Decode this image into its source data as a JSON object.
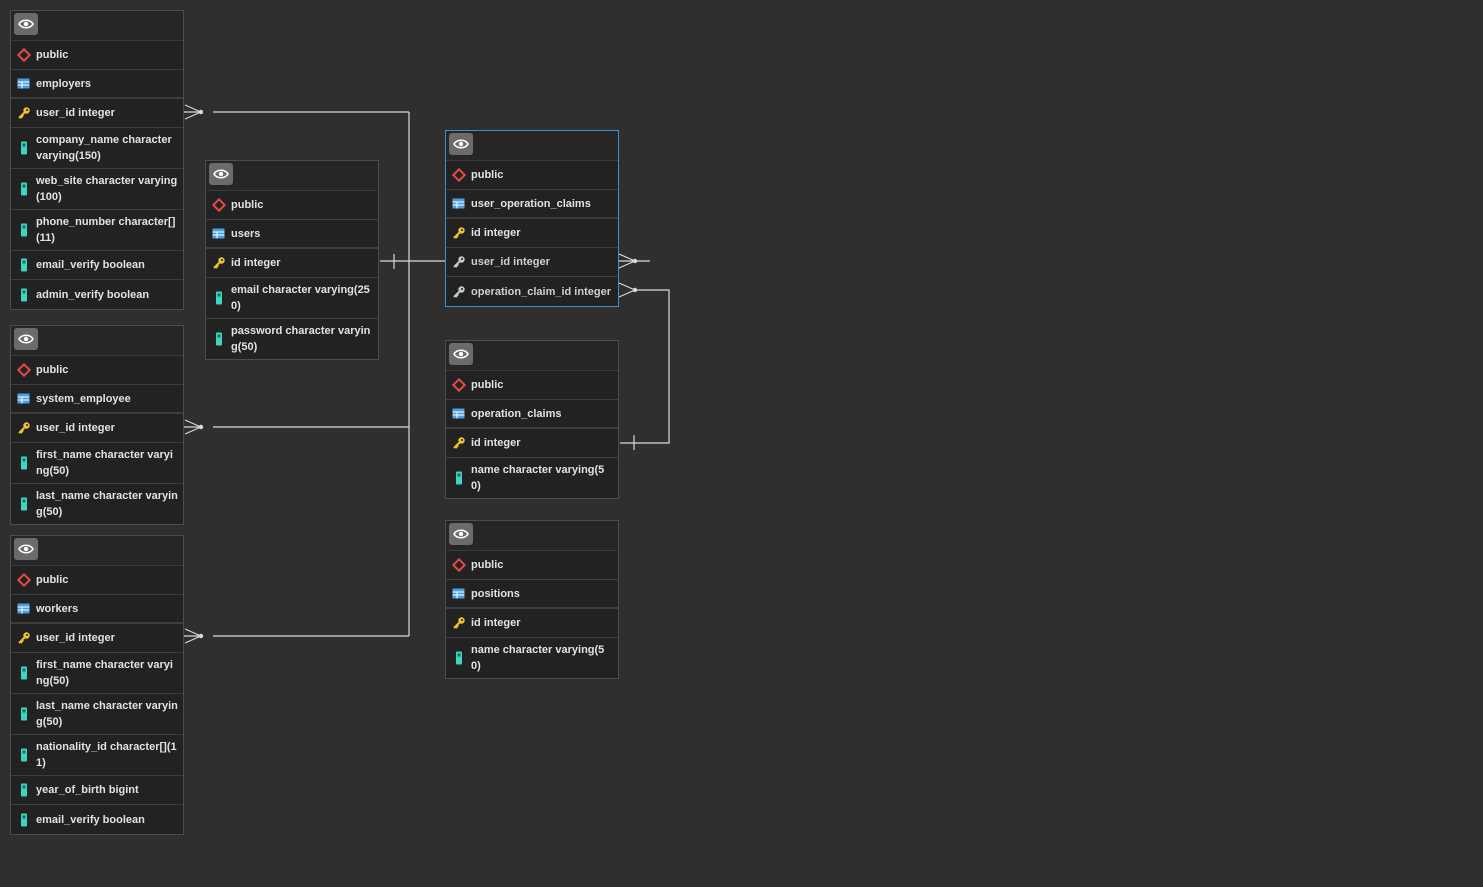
{
  "colors": {
    "background": "#2f2f2f",
    "table_bg": "#222222",
    "selected_border": "#3d8fd6",
    "relation_line": "#d9d9d9",
    "schema_icon": "#e24a4a",
    "table_icon": "#4a9fe0",
    "pk_icon": "#f2c12e",
    "column_icon": "#3ed5c0"
  },
  "tables": [
    {
      "id": "employers",
      "schema": "public",
      "name": "employers",
      "selected": false,
      "columns": [
        {
          "text": "user_id integer",
          "kind": "pk"
        },
        {
          "text": "company_name character varying(150)",
          "kind": "col"
        },
        {
          "text": "web_site character varying(100)",
          "kind": "col"
        },
        {
          "text": "phone_number character[](11)",
          "kind": "col"
        },
        {
          "text": "email_verify boolean",
          "kind": "col"
        },
        {
          "text": "admin_verify boolean",
          "kind": "col"
        }
      ]
    },
    {
      "id": "system_employee",
      "schema": "public",
      "name": "system_employee",
      "selected": false,
      "columns": [
        {
          "text": "user_id integer",
          "kind": "pk"
        },
        {
          "text": "first_name character varying(50)",
          "kind": "col"
        },
        {
          "text": "last_name character varying(50)",
          "kind": "col"
        }
      ]
    },
    {
      "id": "workers",
      "schema": "public",
      "name": "workers",
      "selected": false,
      "columns": [
        {
          "text": "user_id integer",
          "kind": "pk"
        },
        {
          "text": "first_name character varying(50)",
          "kind": "col"
        },
        {
          "text": "last_name character varying(50)",
          "kind": "col"
        },
        {
          "text": "nationality_id character[](11)",
          "kind": "col"
        },
        {
          "text": "year_of_birth bigint",
          "kind": "col"
        },
        {
          "text": "email_verify boolean",
          "kind": "col"
        }
      ]
    },
    {
      "id": "users",
      "schema": "public",
      "name": "users",
      "selected": false,
      "columns": [
        {
          "text": "id integer",
          "kind": "pk"
        },
        {
          "text": "email character varying(250)",
          "kind": "col"
        },
        {
          "text": "password character varying(50)",
          "kind": "col"
        }
      ]
    },
    {
      "id": "user_operation_claims",
      "schema": "public",
      "name": "user_operation_claims",
      "selected": true,
      "columns": [
        {
          "text": "id integer",
          "kind": "pk"
        },
        {
          "text": "user_id integer",
          "kind": "fk"
        },
        {
          "text": "operation_claim_id integer",
          "kind": "fk"
        }
      ]
    },
    {
      "id": "operation_claims",
      "schema": "public",
      "name": "operation_claims",
      "selected": false,
      "columns": [
        {
          "text": "id integer",
          "kind": "pk"
        },
        {
          "text": "name character varying(50)",
          "kind": "col"
        }
      ]
    },
    {
      "id": "positions",
      "schema": "public",
      "name": "positions",
      "selected": false,
      "columns": [
        {
          "text": "id integer",
          "kind": "pk"
        },
        {
          "text": "name character varying(50)",
          "kind": "col"
        }
      ]
    }
  ]
}
